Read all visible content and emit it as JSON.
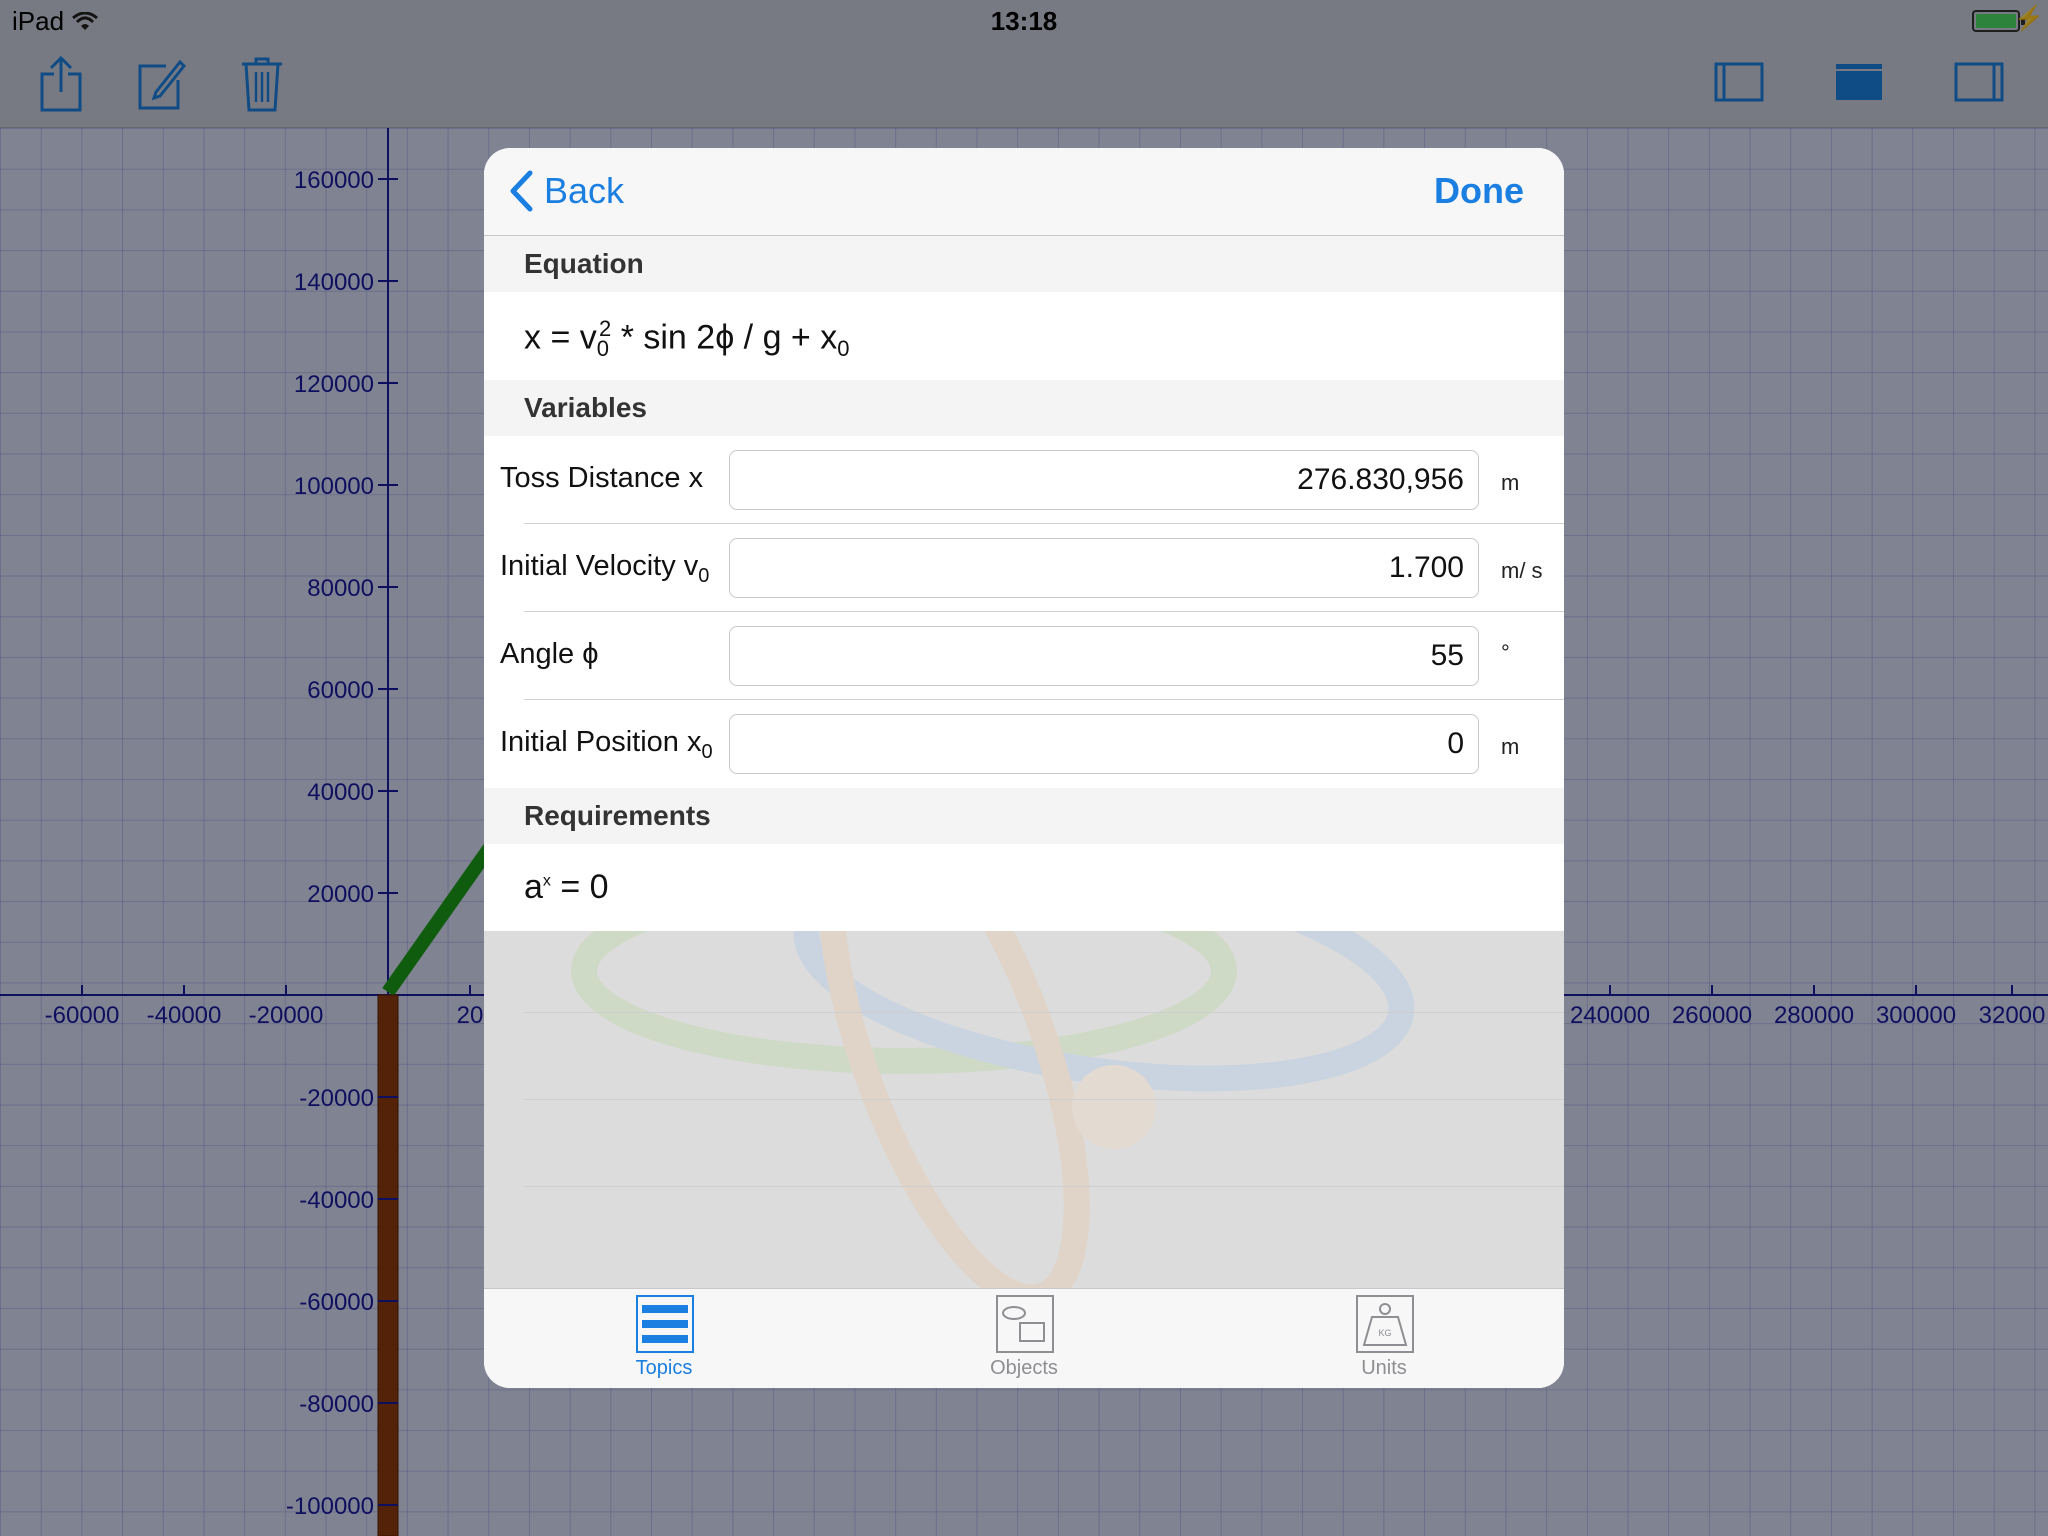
{
  "status_bar": {
    "carrier": "iPad",
    "time": "13:18"
  },
  "toolbar": {
    "left_icons": [
      "share-icon",
      "edit-icon",
      "trash-icon"
    ],
    "right_icons": [
      "sidebar-left-icon",
      "panel-top-icon",
      "sidebar-right-icon"
    ]
  },
  "graph": {
    "y_ticks": [
      "160000",
      "140000",
      "120000",
      "100000",
      "80000",
      "60000",
      "40000",
      "20000",
      "-20000",
      "-40000",
      "-60000",
      "-80000",
      "-100000"
    ],
    "x_ticks_left": [
      "-60000",
      "-40000",
      "-20000",
      "20"
    ],
    "x_ticks_right": [
      "240000",
      "260000",
      "280000",
      "300000",
      "32000"
    ]
  },
  "modal": {
    "back_label": "Back",
    "done_label": "Done",
    "equation_header": "Equation",
    "equation": {
      "lhs": "x = v",
      "v_sub": "0",
      "v_sup": "2",
      "rhs": " * sin 2ϕ / g + x",
      "x_sub": "0"
    },
    "variables_header": "Variables",
    "variables": [
      {
        "label": "Toss Distance x",
        "sub": "",
        "value": "276.830,956",
        "unit": "m"
      },
      {
        "label": "Initial Velocity v",
        "sub": "0",
        "value": "1.700",
        "unit": "m/ s"
      },
      {
        "label": "Angle ϕ",
        "sub": "",
        "value": "55",
        "unit": "°"
      },
      {
        "label": "Initial Position x",
        "sub": "0",
        "value": "0",
        "unit": "m"
      }
    ],
    "requirements_header": "Requirements",
    "requirement": {
      "base": "a",
      "sup": "x",
      "rest": " = 0"
    }
  },
  "tabbar": {
    "tabs": [
      {
        "label": "Topics",
        "icon": "list-icon",
        "selected": true
      },
      {
        "label": "Objects",
        "icon": "objects-icon",
        "selected": false
      },
      {
        "label": "Units",
        "icon": "weight-icon",
        "selected": false
      }
    ]
  },
  "colors": {
    "accent": "#1a7fe0",
    "axis": "#1a1aa0",
    "line_green": "#1a9a1a",
    "bar_brown": "#8b3a10"
  }
}
